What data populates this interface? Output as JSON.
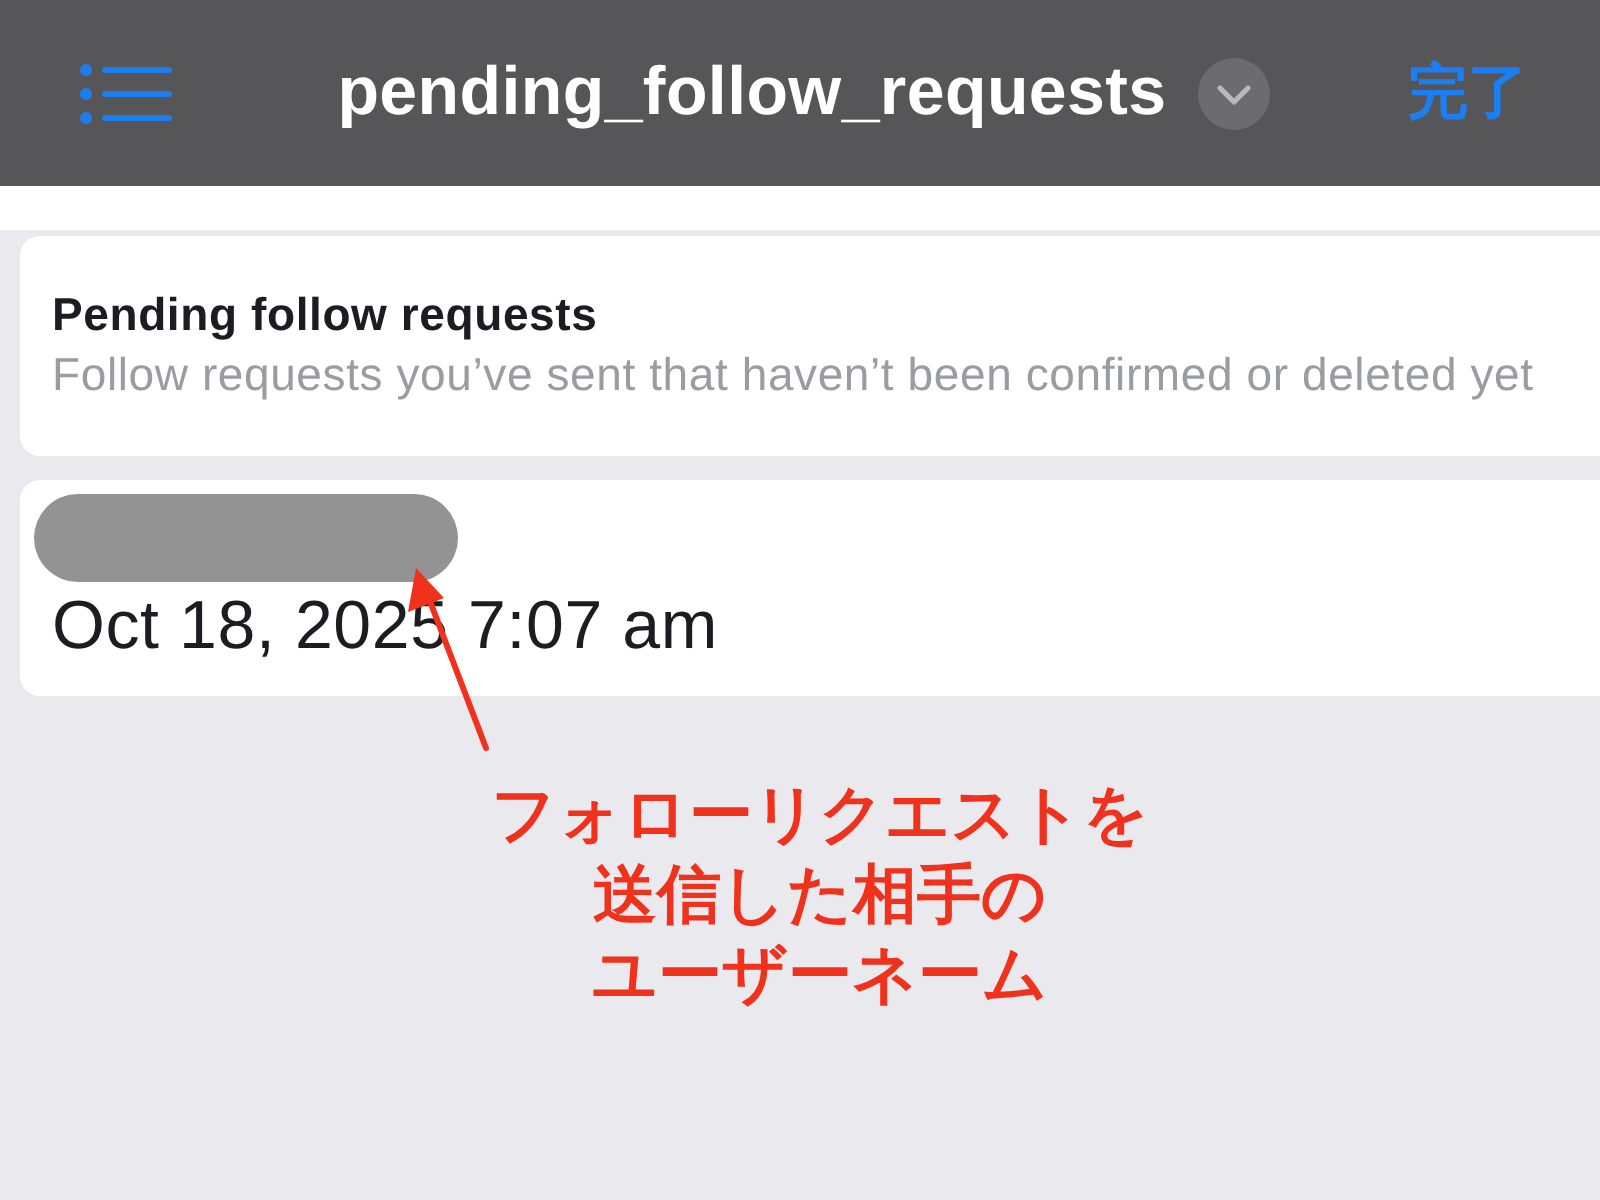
{
  "header": {
    "title": "pending_follow_requests",
    "done_label": "完了"
  },
  "info_card": {
    "title": "Pending follow requests",
    "description": "Follow requests you’ve sent that haven’t been confirmed or deleted yet"
  },
  "requests": [
    {
      "date": "Oct 18, 2025 7:07 am"
    }
  ],
  "annotation": {
    "lines": [
      "フォローリクエストを",
      "送信した相手の",
      "ユーザーネーム"
    ]
  }
}
